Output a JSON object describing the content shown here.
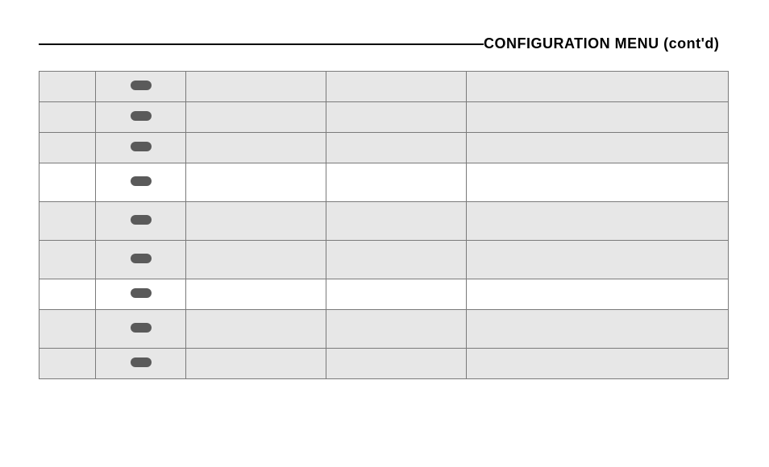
{
  "header": {
    "title": "CONFIGURATION MENU (cont'd)"
  },
  "table": {
    "rows": [
      {
        "style": "shaded",
        "tall": false,
        "icon_align": "center",
        "c1": "",
        "c3": "",
        "c4": "",
        "c5": ""
      },
      {
        "style": "shaded",
        "tall": false,
        "icon_align": "center",
        "c1": "",
        "c3": "",
        "c4": "",
        "c5": ""
      },
      {
        "style": "shaded",
        "tall": false,
        "icon_align": "center",
        "c1": "",
        "c3": "",
        "c4": "",
        "c5": ""
      },
      {
        "style": "white",
        "tall": true,
        "icon_align": "center",
        "c1": "",
        "c3": "",
        "c4": "",
        "c5": ""
      },
      {
        "style": "shaded",
        "tall": true,
        "icon_align": "center",
        "c1": "",
        "c3": "",
        "c4": "",
        "c5": ""
      },
      {
        "style": "shaded",
        "tall": true,
        "icon_align": "center",
        "c1": "",
        "c3": "",
        "c4": "",
        "c5": ""
      },
      {
        "style": "white",
        "tall": false,
        "icon_align": "center",
        "c1": "",
        "c3": "",
        "c4": "",
        "c5": ""
      },
      {
        "style": "shaded",
        "tall": true,
        "icon_align": "center",
        "c1": "",
        "c3": "",
        "c4": "",
        "c5": ""
      },
      {
        "style": "shaded",
        "tall": false,
        "icon_align": "right",
        "c1": "",
        "c3": "",
        "c4": "",
        "c5": ""
      }
    ]
  }
}
